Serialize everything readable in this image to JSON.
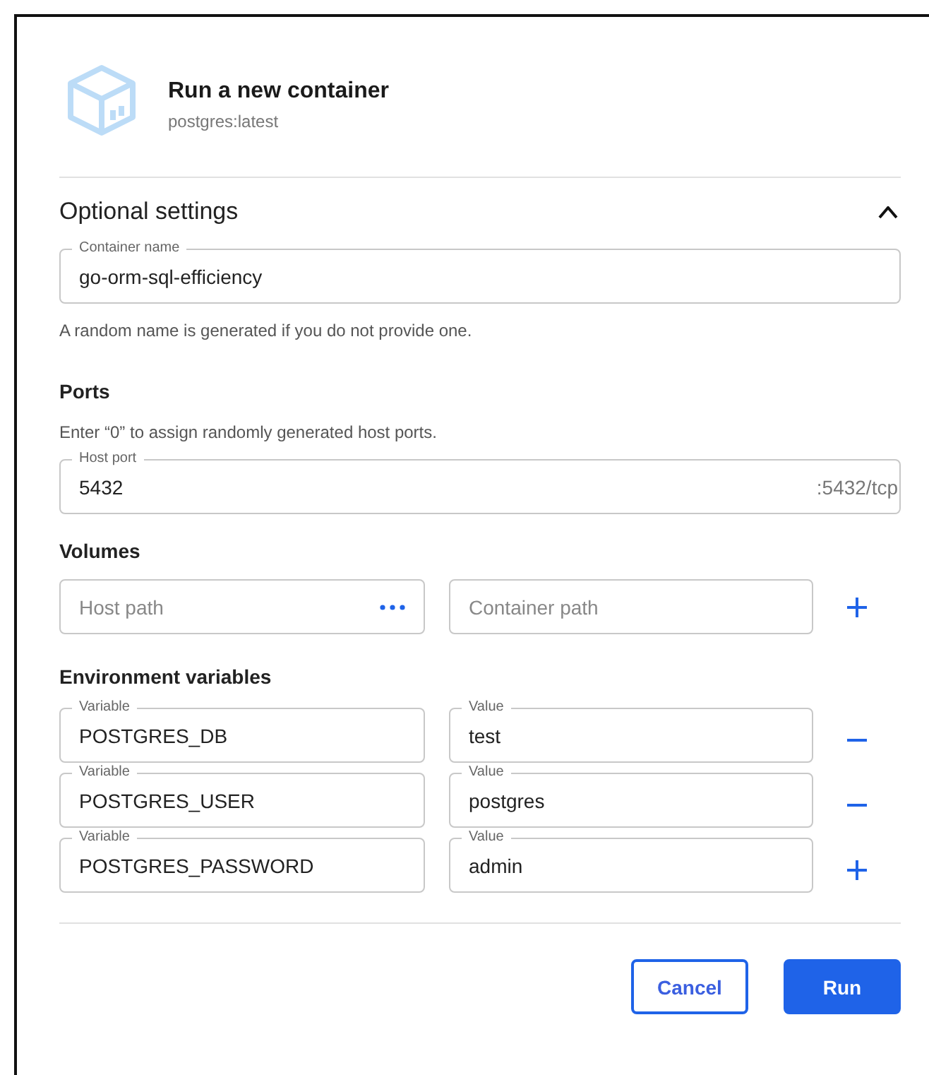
{
  "header": {
    "title": "Run a new container",
    "subtitle": "postgres:latest"
  },
  "optional_settings": {
    "title": "Optional settings",
    "expanded": true
  },
  "container_name": {
    "label": "Container name",
    "value": "go-orm-sql-efficiency",
    "hint": "A random name is generated if you do not provide one."
  },
  "ports": {
    "title": "Ports",
    "hint": "Enter “0” to assign randomly generated host ports.",
    "host_port": {
      "label": "Host port",
      "value": "5432",
      "suffix": ":5432/tcp"
    }
  },
  "volumes": {
    "title": "Volumes",
    "host_path": {
      "placeholder": "Host path"
    },
    "container_path": {
      "placeholder": "Container path"
    }
  },
  "environment": {
    "title": "Environment variables",
    "rows": [
      {
        "variable_label": "Variable",
        "variable": "POSTGRES_DB",
        "value_label": "Value",
        "value": "test",
        "kind": "remove"
      },
      {
        "variable_label": "Variable",
        "variable": "POSTGRES_USER",
        "value_label": "Value",
        "value": "postgres",
        "kind": "remove"
      },
      {
        "variable_label": "Variable",
        "variable": "POSTGRES_PASSWORD",
        "value_label": "Value",
        "value": "admin",
        "kind": "add"
      }
    ]
  },
  "buttons": [
    {
      "label": "Cancel",
      "kind": "secondary"
    },
    {
      "label": "Run",
      "kind": "primary"
    }
  ]
}
